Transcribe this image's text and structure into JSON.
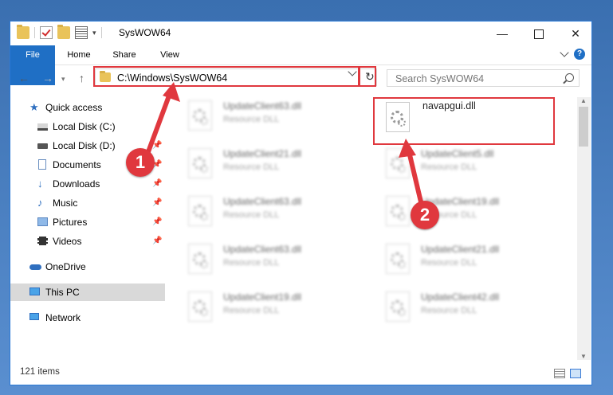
{
  "window": {
    "title": "SysWOW64",
    "minimize_label": "—",
    "close_label": "✕"
  },
  "ribbon": {
    "tabs": [
      "File",
      "Home",
      "Share",
      "View"
    ]
  },
  "nav": {
    "back_glyph": "←",
    "forward_glyph": "→",
    "recent_glyph": "▾",
    "up_glyph": "↑",
    "address_path": "C:\\Windows\\SysWOW64",
    "refresh_glyph": "↻",
    "search_placeholder": "Search SysWOW64"
  },
  "sidebar": {
    "items": [
      {
        "label": "Quick access",
        "icon": "star-icon",
        "pinned": false
      },
      {
        "label": "Local Disk (C:)",
        "icon": "drive-icon",
        "pinned": false
      },
      {
        "label": "Local Disk (D:)",
        "icon": "drive-icon",
        "pinned": true
      },
      {
        "label": "Documents",
        "icon": "documents-icon",
        "pinned": true
      },
      {
        "label": "Downloads",
        "icon": "downloads-icon",
        "pinned": true
      },
      {
        "label": "Music",
        "icon": "music-icon",
        "pinned": true
      },
      {
        "label": "Pictures",
        "icon": "pictures-icon",
        "pinned": true
      },
      {
        "label": "Videos",
        "icon": "videos-icon",
        "pinned": true
      },
      {
        "label": "OneDrive",
        "icon": "onedrive-icon",
        "pinned": false
      },
      {
        "label": "This PC",
        "icon": "this-pc-icon",
        "pinned": false,
        "selected": true
      },
      {
        "label": "Network",
        "icon": "network-icon",
        "pinned": false
      }
    ]
  },
  "files": {
    "target": {
      "name": "navapgui.dll"
    },
    "left_column": [
      {
        "name": "UpdateClient63.dll",
        "type": "Resource DLL"
      },
      {
        "name": "UpdateClient21.dll",
        "type": "Resource DLL"
      },
      {
        "name": "UpdateClient63.dll",
        "type": "Resource DLL"
      },
      {
        "name": "UpdateClient63.dll",
        "type": "Resource DLL"
      },
      {
        "name": "UpdateClient19.dll",
        "type": "Resource DLL"
      }
    ],
    "right_column": [
      {
        "name": "UpdateClient5.dll",
        "type": "Resource DLL"
      },
      {
        "name": "UpdateClient19.dll",
        "type": "Resource DLL"
      },
      {
        "name": "UpdateClient21.dll",
        "type": "Resource DLL"
      },
      {
        "name": "UpdateClient42.dll",
        "type": "Resource DLL"
      }
    ]
  },
  "status": {
    "item_count": "121 items"
  },
  "callouts": {
    "step1": "1",
    "step2": "2",
    "color": "#e0383e"
  }
}
